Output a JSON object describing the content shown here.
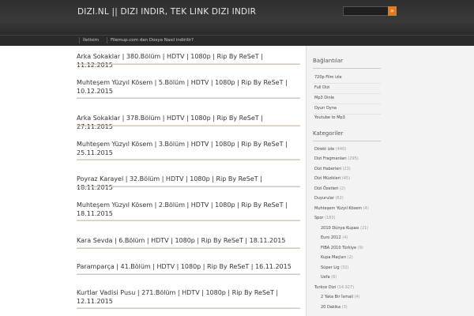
{
  "header": {
    "title": "DIZI.NL || DIZI INDIR, TEK LINK DIZI INDIR",
    "search_button": "»"
  },
  "nav": [
    {
      "label": "İletisim"
    },
    {
      "label": "Filemup.com dan Dosya Nasıl indirilir?"
    }
  ],
  "posts": [
    {
      "title": "Arka Sokaklar | 380.Bölüm | HDTV | 1080p | Rip By ReSeT | 11.12.2015"
    },
    {
      "title": "Muhteşem Yüzyıl Kösem | 5.Bölüm | HDTV | 1080p | Rip By ReSeT | 10.12.2015"
    },
    {
      "title": "Arka Sokaklar | 378.Bölüm | HDTV | 1080p | Rip By ReSeT | 27.11.2015"
    },
    {
      "title": "Muhteşem Yüzyıl Kösem | 3.Bölüm | HDTV | 1080p | Rip By ReSeT | 25.11.2015"
    },
    {
      "title": "Poyraz Karayel | 32.Bölüm | HDTV | 1080p | Rip By ReSeT | 18.11.2015"
    },
    {
      "title": "Muhteşem Yüzyıl Kösem | 2.Bölüm | HDTV | 1080p | Rip By ReSeT | 18.11.2015"
    },
    {
      "title": "Kara Sevda | 6.Bölüm | HDTV | 1080p | Rip By ReSeT | 18.11.2015"
    },
    {
      "title": "Paramparça | 41.Bölüm | HDTV | 1080p | Rip By ReSeT | 16.11.2015"
    },
    {
      "title": "Kurtlar Vadisi Pusu | 271.Bölüm | HDTV | 1080p | Rip By ReSeT | 12.11.2015"
    }
  ],
  "sidebar": {
    "links_title": "Bağlantılar",
    "links": [
      {
        "label": "720p Film izle"
      },
      {
        "label": "Full Dizi"
      },
      {
        "label": "Mp3 Dinle"
      },
      {
        "label": "Oyun Oyna"
      },
      {
        "label": "Youtube to Mp3"
      }
    ],
    "categories_title": "Kategoriler",
    "categories": [
      {
        "label": "Direkt izle",
        "count": "(440)"
      },
      {
        "label": "Dizi Fragmanları",
        "count": "(295)"
      },
      {
        "label": "Dizi Haberleri",
        "count": "(23)"
      },
      {
        "label": "Dizi Müzikleri",
        "count": "(45)"
      },
      {
        "label": "Dizi Özetleri",
        "count": "(2)"
      },
      {
        "label": "Duyurular",
        "count": "(62)"
      },
      {
        "label": "Muhteşem Yüzyıl Kösem",
        "count": "(4)"
      },
      {
        "label": "Spor",
        "count": "(183)"
      },
      {
        "label": "2010 Dünya Kupası",
        "count": "(21)"
      },
      {
        "label": "Euro 2012",
        "count": "(4)"
      },
      {
        "label": "FIBA 2010 Türkiye",
        "count": "(9)"
      },
      {
        "label": "Kupa Maçları",
        "count": "(2)"
      },
      {
        "label": "Süper Lig",
        "count": "(32)"
      },
      {
        "label": "Uefa",
        "count": "(6)"
      },
      {
        "label": "Turkce Dizi",
        "count": "(14.927)"
      },
      {
        "label": "2 Yaka Bir İsmail",
        "count": "(4)"
      },
      {
        "label": "20 Dakika",
        "count": "(3)"
      }
    ]
  }
}
